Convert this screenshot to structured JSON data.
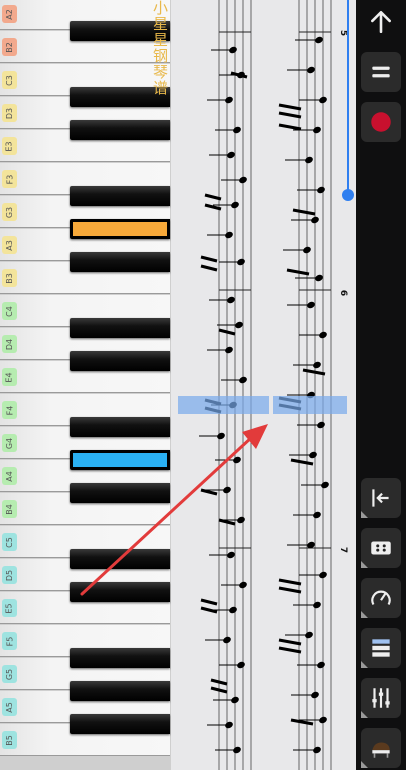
{
  "keyboard": {
    "white_keys": [
      {
        "note": "A2",
        "color": "#f2a98d"
      },
      {
        "note": "B2",
        "color": "#f2a98d"
      },
      {
        "note": "C3",
        "color": "#f3e49b"
      },
      {
        "note": "D3",
        "color": "#f3e49b"
      },
      {
        "note": "E3",
        "color": "#f3e49b"
      },
      {
        "note": "F3",
        "color": "#f3e49b"
      },
      {
        "note": "G3",
        "color": "#f3e49b"
      },
      {
        "note": "A3",
        "color": "#f3e49b"
      },
      {
        "note": "B3",
        "color": "#f3e49b"
      },
      {
        "note": "C4",
        "color": "#b6ecb0"
      },
      {
        "note": "D4",
        "color": "#b6ecb0"
      },
      {
        "note": "E4",
        "color": "#b6ecb0"
      },
      {
        "note": "F4",
        "color": "#b6ecb0"
      },
      {
        "note": "G4",
        "color": "#b6ecb0"
      },
      {
        "note": "A4",
        "color": "#b6ecb0"
      },
      {
        "note": "B4",
        "color": "#b6ecb0"
      },
      {
        "note": "C5",
        "color": "#9ee3e0"
      },
      {
        "note": "D5",
        "color": "#9ee3e0"
      },
      {
        "note": "E5",
        "color": "#9ee3e0"
      },
      {
        "note": "F5",
        "color": "#9ee3e0"
      },
      {
        "note": "G5",
        "color": "#9ee3e0"
      },
      {
        "note": "A5",
        "color": "#9ee3e0"
      },
      {
        "note": "B5",
        "color": "#9ee3e0"
      }
    ],
    "active_keys": [
      {
        "between": "G3-A3",
        "color": "#f7a93a"
      },
      {
        "between": "G4-A4",
        "color": "#2ab0f2"
      }
    ]
  },
  "score": {
    "title": "小星星钢琴谱",
    "measure_numbers": [
      "5",
      "6",
      "7"
    ],
    "highlight_color": "#7fb0ec"
  },
  "toolbar": {
    "up": "arrow-up-icon",
    "menu": "menu-icon",
    "record": "record-icon",
    "record_color": "#c8102e",
    "exit": "exit-icon",
    "display": "keyboard-display-icon",
    "speed": "metronome-icon",
    "sheet": "sheet-icon",
    "mixer": "mixer-icon",
    "instrument": "piano-instrument-icon"
  },
  "annotation": {
    "arrow_color": "#e23b3b"
  }
}
